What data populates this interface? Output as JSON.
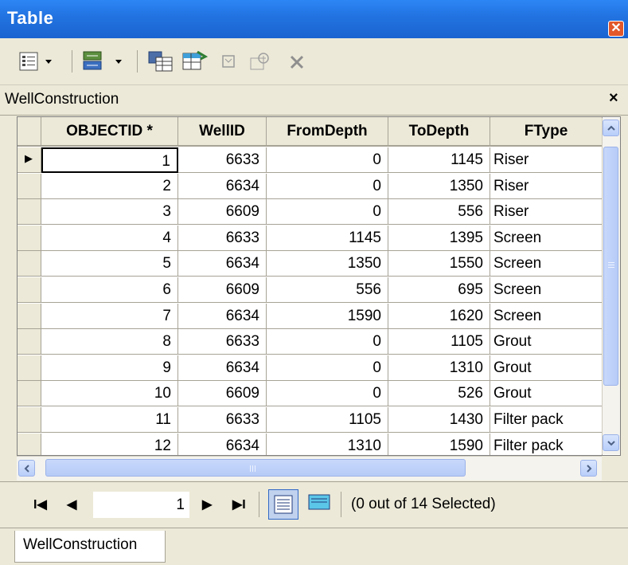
{
  "window": {
    "title": "Table",
    "close_label": "✕"
  },
  "toolbar": {
    "icons": [
      "table-options-icon",
      "related-tables-icon",
      "select-by-attributes-icon",
      "switch-selection-icon",
      "clear-selection-icon",
      "zoom-to-selected-icon",
      "delete-selected-icon"
    ]
  },
  "tab": {
    "name": "WellConstruction",
    "close_label": "×"
  },
  "table": {
    "columns": [
      "OBJECTID *",
      "WellID",
      "FromDepth",
      "ToDepth",
      "FType"
    ],
    "rows": [
      [
        "1",
        "6633",
        "0",
        "1145",
        "Riser"
      ],
      [
        "2",
        "6634",
        "0",
        "1350",
        "Riser"
      ],
      [
        "3",
        "6609",
        "0",
        "556",
        "Riser"
      ],
      [
        "4",
        "6633",
        "1145",
        "1395",
        "Screen"
      ],
      [
        "5",
        "6634",
        "1350",
        "1550",
        "Screen"
      ],
      [
        "6",
        "6609",
        "556",
        "695",
        "Screen"
      ],
      [
        "7",
        "6634",
        "1590",
        "1620",
        "Screen"
      ],
      [
        "8",
        "6633",
        "0",
        "1105",
        "Grout"
      ],
      [
        "9",
        "6634",
        "0",
        "1310",
        "Grout"
      ],
      [
        "10",
        "6609",
        "0",
        "526",
        "Grout"
      ],
      [
        "11",
        "6633",
        "1105",
        "1430",
        "Filter pack"
      ],
      [
        "12",
        "6634",
        "1310",
        "1590",
        "Filter pack"
      ]
    ],
    "current_row_marker": "▶"
  },
  "navigation": {
    "first": "I◀",
    "prev": "◀",
    "record": "1",
    "next": "▶",
    "last": "▶I",
    "selection_status": "(0 out of 14 Selected)"
  },
  "bottom_tab": {
    "label": "WellConstruction"
  }
}
